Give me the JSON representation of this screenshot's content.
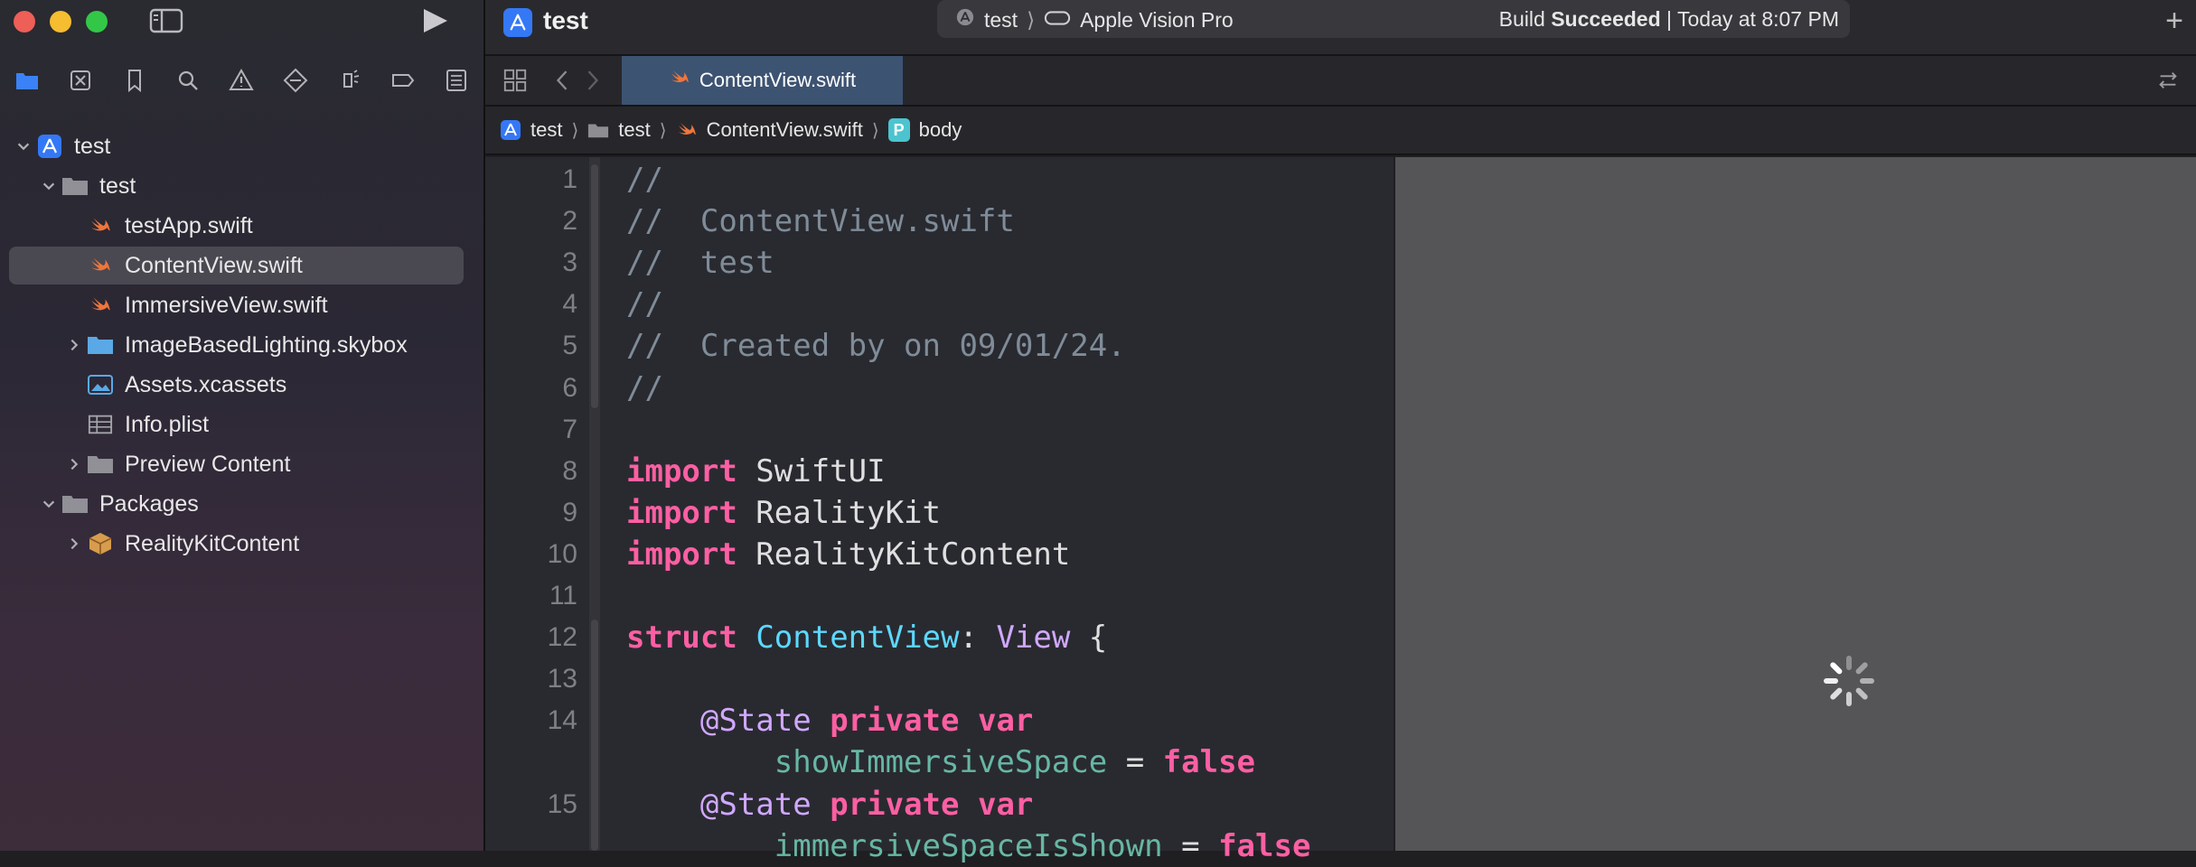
{
  "colors": {
    "accent": "#3478f6",
    "swift_orange": "#f0753a",
    "keyword": "#fc5fa3",
    "type": "#5dd8ff",
    "comment": "#7f8c98"
  },
  "sidebar": {
    "navigator_icons": [
      "folder-icon",
      "source-control-icon",
      "bookmark-icon",
      "search-icon",
      "warning-icon",
      "test-icon",
      "debug-icon",
      "breakpoint-icon",
      "report-icon"
    ],
    "tree": [
      {
        "label": "test",
        "icon": "project-icon",
        "level": 0,
        "disclosure": "open"
      },
      {
        "label": "test",
        "icon": "folder-icon",
        "level": 1,
        "disclosure": "open"
      },
      {
        "label": "testApp.swift",
        "icon": "swift-icon",
        "level": 2,
        "disclosure": "none"
      },
      {
        "label": "ContentView.swift",
        "icon": "swift-icon",
        "level": 2,
        "disclosure": "none",
        "selected": true
      },
      {
        "label": "ImmersiveView.swift",
        "icon": "swift-icon",
        "level": 2,
        "disclosure": "none"
      },
      {
        "label": "ImageBasedLighting.skybox",
        "icon": "blue-folder-icon",
        "level": 2,
        "disclosure": "closed"
      },
      {
        "label": "Assets.xcassets",
        "icon": "assets-icon",
        "level": 2,
        "disclosure": "none"
      },
      {
        "label": "Info.plist",
        "icon": "plist-icon",
        "level": 2,
        "disclosure": "none"
      },
      {
        "label": "Preview Content",
        "icon": "folder-icon",
        "level": 2,
        "disclosure": "closed"
      },
      {
        "label": "Packages",
        "icon": "folder-icon",
        "level": 1,
        "disclosure": "open"
      },
      {
        "label": "RealityKitContent",
        "icon": "package-icon",
        "level": 2,
        "disclosure": "closed"
      }
    ]
  },
  "toolbar": {
    "project_name": "test",
    "scheme": "test",
    "destination": "Apple Vision Pro",
    "status_prefix": "Build ",
    "status_bold": "Succeeded",
    "status_suffix": " | Today at 8:07 PM",
    "plus": "+"
  },
  "tabs": {
    "active_label": "ContentView.swift"
  },
  "breadcrumbs": [
    "test",
    "test",
    "ContentView.swift",
    "body"
  ],
  "breadcrumb_badge": "P",
  "editor": {
    "lines": [
      {
        "num": "1",
        "tokens": [
          {
            "t": "//",
            "c": "com"
          }
        ]
      },
      {
        "num": "2",
        "tokens": [
          {
            "t": "//  ContentView.swift",
            "c": "com"
          }
        ]
      },
      {
        "num": "3",
        "tokens": [
          {
            "t": "//  test",
            "c": "com"
          }
        ]
      },
      {
        "num": "4",
        "tokens": [
          {
            "t": "//",
            "c": "com"
          }
        ]
      },
      {
        "num": "5",
        "tokens": [
          {
            "t": "//  Created by on 09/01/24.",
            "c": "com"
          }
        ]
      },
      {
        "num": "6",
        "tokens": [
          {
            "t": "//",
            "c": "com"
          }
        ]
      },
      {
        "num": "7",
        "tokens": []
      },
      {
        "num": "8",
        "tokens": [
          {
            "t": "import",
            "c": "kw"
          },
          {
            "t": " SwiftUI",
            "c": "plain"
          }
        ]
      },
      {
        "num": "9",
        "tokens": [
          {
            "t": "import",
            "c": "kw"
          },
          {
            "t": " RealityKit",
            "c": "plain"
          }
        ]
      },
      {
        "num": "10",
        "tokens": [
          {
            "t": "import",
            "c": "kw"
          },
          {
            "t": " RealityKitContent",
            "c": "plain"
          }
        ]
      },
      {
        "num": "11",
        "tokens": []
      },
      {
        "num": "12",
        "tokens": [
          {
            "t": "struct",
            "c": "kw"
          },
          {
            "t": " ",
            "c": "plain"
          },
          {
            "t": "ContentView",
            "c": "type"
          },
          {
            "t": ": ",
            "c": "plain"
          },
          {
            "t": "View",
            "c": "sys"
          },
          {
            "t": " {",
            "c": "plain"
          }
        ]
      },
      {
        "num": "13",
        "tokens": []
      },
      {
        "num": "14",
        "tokens": [
          {
            "t": "    ",
            "c": "plain"
          },
          {
            "t": "@State",
            "c": "attr"
          },
          {
            "t": " ",
            "c": "plain"
          },
          {
            "t": "private",
            "c": "kw"
          },
          {
            "t": " ",
            "c": "plain"
          },
          {
            "t": "var",
            "c": "kw"
          }
        ]
      },
      {
        "num": "",
        "tokens": [
          {
            "t": "        ",
            "c": "plain"
          },
          {
            "t": "showImmersiveSpace",
            "c": "prop"
          },
          {
            "t": " = ",
            "c": "plain"
          },
          {
            "t": "false",
            "c": "kw"
          }
        ]
      },
      {
        "num": "15",
        "tokens": [
          {
            "t": "    ",
            "c": "plain"
          },
          {
            "t": "@State",
            "c": "attr"
          },
          {
            "t": " ",
            "c": "plain"
          },
          {
            "t": "private",
            "c": "kw"
          },
          {
            "t": " ",
            "c": "plain"
          },
          {
            "t": "var",
            "c": "kw"
          }
        ]
      },
      {
        "num": "",
        "tokens": [
          {
            "t": "        ",
            "c": "plain"
          },
          {
            "t": "immersiveSpaceIsShown",
            "c": "prop"
          },
          {
            "t": " = ",
            "c": "plain"
          },
          {
            "t": "false",
            "c": "kw"
          }
        ]
      }
    ]
  }
}
